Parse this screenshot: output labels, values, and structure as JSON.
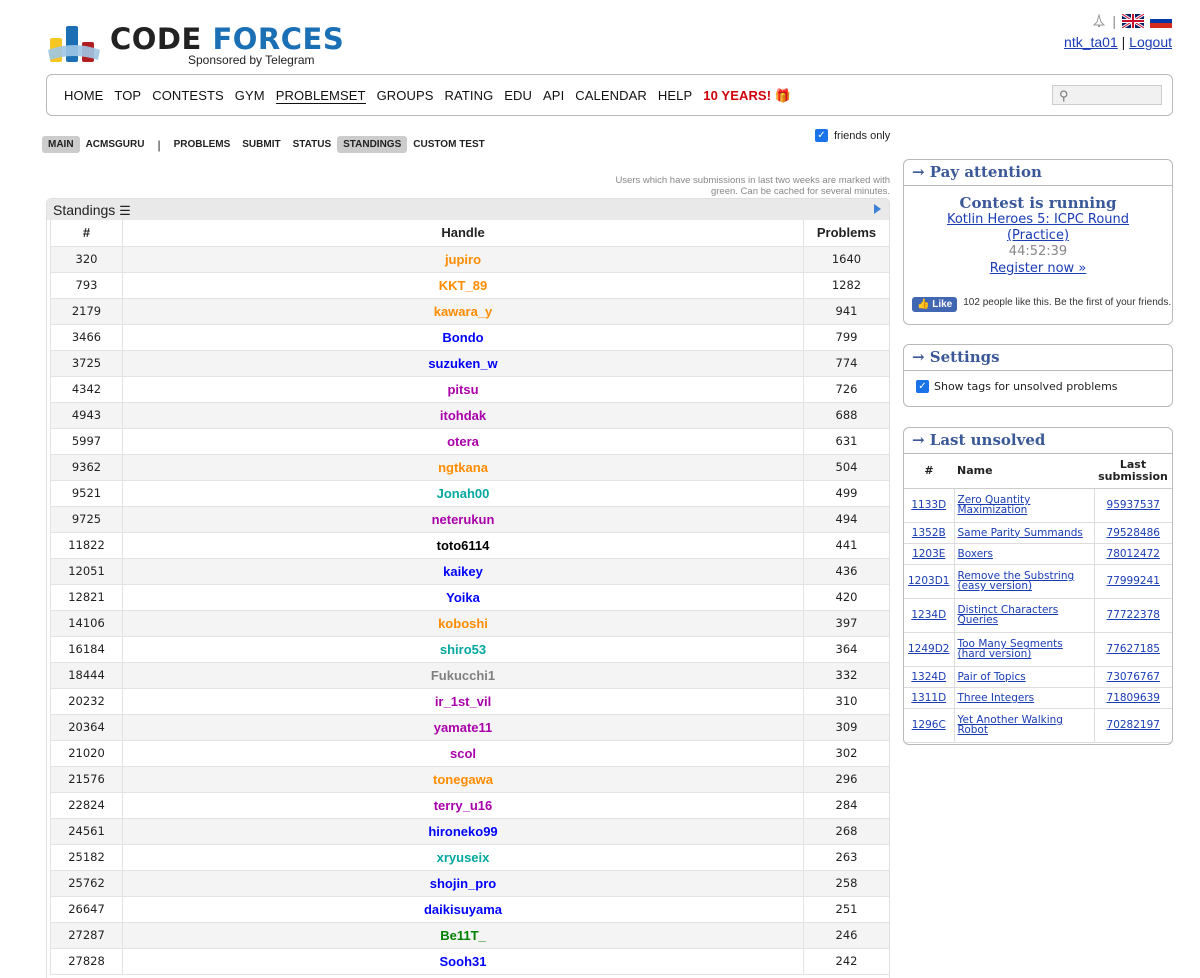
{
  "header": {
    "logo_code": "CODE",
    "logo_forces": "FORCES",
    "sponsor": "Sponsored by Telegram",
    "user": "ntk_ta01",
    "separator": "|",
    "logout": "Logout"
  },
  "menu": {
    "items": [
      "HOME",
      "TOP",
      "CONTESTS",
      "GYM",
      "PROBLEMSET",
      "GROUPS",
      "RATING",
      "EDU",
      "API",
      "CALENDAR",
      "HELP"
    ],
    "active": "PROBLEMSET",
    "special": "10 YEARS!"
  },
  "submenu": {
    "left": [
      "MAIN",
      "ACMSGURU"
    ],
    "separator": "|",
    "right": [
      "PROBLEMS",
      "SUBMIT",
      "STATUS",
      "STANDINGS",
      "CUSTOM TEST"
    ]
  },
  "friends_only": "friends only",
  "note_line1": "Users which have submissions in last two weeks are marked with",
  "note_line2": "green. Can be cached for several minutes.",
  "standings": {
    "title": "Standings",
    "col_rank": "#",
    "col_handle": "Handle",
    "col_problems": "Problems",
    "rows": [
      {
        "rank": "320",
        "handle": "jupiro",
        "problems": "1640",
        "color": "#ff8c00"
      },
      {
        "rank": "793",
        "handle": "KKT_89",
        "problems": "1282",
        "color": "#ff8c00"
      },
      {
        "rank": "2179",
        "handle": "kawara_y",
        "problems": "941",
        "color": "#ff8c00"
      },
      {
        "rank": "3466",
        "handle": "Bondo",
        "problems": "799",
        "color": "#0000ff"
      },
      {
        "rank": "3725",
        "handle": "suzuken_w",
        "problems": "774",
        "color": "#0000ff"
      },
      {
        "rank": "4342",
        "handle": "pitsu",
        "problems": "726",
        "color": "#aa00aa"
      },
      {
        "rank": "4943",
        "handle": "itohdak",
        "problems": "688",
        "color": "#aa00aa"
      },
      {
        "rank": "5997",
        "handle": "otera",
        "problems": "631",
        "color": "#aa00aa"
      },
      {
        "rank": "9362",
        "handle": "ngtkana",
        "problems": "504",
        "color": "#ff8c00"
      },
      {
        "rank": "9521",
        "handle": "Jonah00",
        "problems": "499",
        "color": "#03a89e"
      },
      {
        "rank": "9725",
        "handle": "neterukun",
        "problems": "494",
        "color": "#aa00aa"
      },
      {
        "rank": "11822",
        "handle": "toto6114",
        "problems": "441",
        "color": "#000000"
      },
      {
        "rank": "12051",
        "handle": "kaikey",
        "problems": "436",
        "color": "#0000ff"
      },
      {
        "rank": "12821",
        "handle": "Yoika",
        "problems": "420",
        "color": "#0000ff"
      },
      {
        "rank": "14106",
        "handle": "koboshi",
        "problems": "397",
        "color": "#ff8c00"
      },
      {
        "rank": "16184",
        "handle": "shiro53",
        "problems": "364",
        "color": "#03a89e"
      },
      {
        "rank": "18444",
        "handle": "Fukucchi1",
        "problems": "332",
        "color": "#808080"
      },
      {
        "rank": "20232",
        "handle": "ir_1st_vil",
        "problems": "310",
        "color": "#aa00aa"
      },
      {
        "rank": "20364",
        "handle": "yamate11",
        "problems": "309",
        "color": "#aa00aa"
      },
      {
        "rank": "21020",
        "handle": "scol",
        "problems": "302",
        "color": "#aa00aa"
      },
      {
        "rank": "21576",
        "handle": "tonegawa",
        "problems": "296",
        "color": "#ff8c00"
      },
      {
        "rank": "22824",
        "handle": "terry_u16",
        "problems": "284",
        "color": "#aa00aa"
      },
      {
        "rank": "24561",
        "handle": "hironeko99",
        "problems": "268",
        "color": "#0000ff"
      },
      {
        "rank": "25182",
        "handle": "xryuseix",
        "problems": "263",
        "color": "#03a89e"
      },
      {
        "rank": "25762",
        "handle": "shojin_pro",
        "problems": "258",
        "color": "#0000ff"
      },
      {
        "rank": "26647",
        "handle": "daikisuyama",
        "problems": "251",
        "color": "#0000ff"
      },
      {
        "rank": "27287",
        "handle": "Be11T_",
        "problems": "246",
        "color": "#008000"
      },
      {
        "rank": "27828",
        "handle": "Sooh31",
        "problems": "242",
        "color": "#0000ff"
      }
    ]
  },
  "pay_attention": {
    "title": "→ Pay attention",
    "status": "Contest is running",
    "contest": "Kotlin Heroes 5: ICPC Round (Practice)",
    "timer": "44:52:39",
    "register": "Register now »",
    "like_label": "Like",
    "like_text": "102 people like this. Be the first of your friends."
  },
  "settings": {
    "title": "→ Settings",
    "option": "Show tags for unsolved problems"
  },
  "last_unsolved": {
    "title": "→ Last unsolved",
    "col_id": "#",
    "col_name": "Name",
    "col_sub_1": "Last",
    "col_sub_2": "submission",
    "rows": [
      {
        "id": "1133D",
        "name": "Zero Quantity Maximization",
        "sub": "95937537",
        "tall": true
      },
      {
        "id": "1352B",
        "name": "Same Parity Summands",
        "sub": "79528486",
        "tall": false
      },
      {
        "id": "1203E",
        "name": "Boxers",
        "sub": "78012472",
        "tall": false
      },
      {
        "id": "1203D1",
        "name": "Remove the Substring (easy version)",
        "sub": "77999241",
        "tall": true
      },
      {
        "id": "1234D",
        "name": "Distinct Characters Queries",
        "sub": "77722378",
        "tall": true
      },
      {
        "id": "1249D2",
        "name": "Too Many Segments (hard version)",
        "sub": "77627185",
        "tall": true
      },
      {
        "id": "1324D",
        "name": "Pair of Topics",
        "sub": "73076767",
        "tall": false
      },
      {
        "id": "1311D",
        "name": "Three Integers",
        "sub": "71809639",
        "tall": false
      },
      {
        "id": "1296C",
        "name": "Yet Another Walking Robot",
        "sub": "70282197",
        "tall": true
      }
    ]
  }
}
